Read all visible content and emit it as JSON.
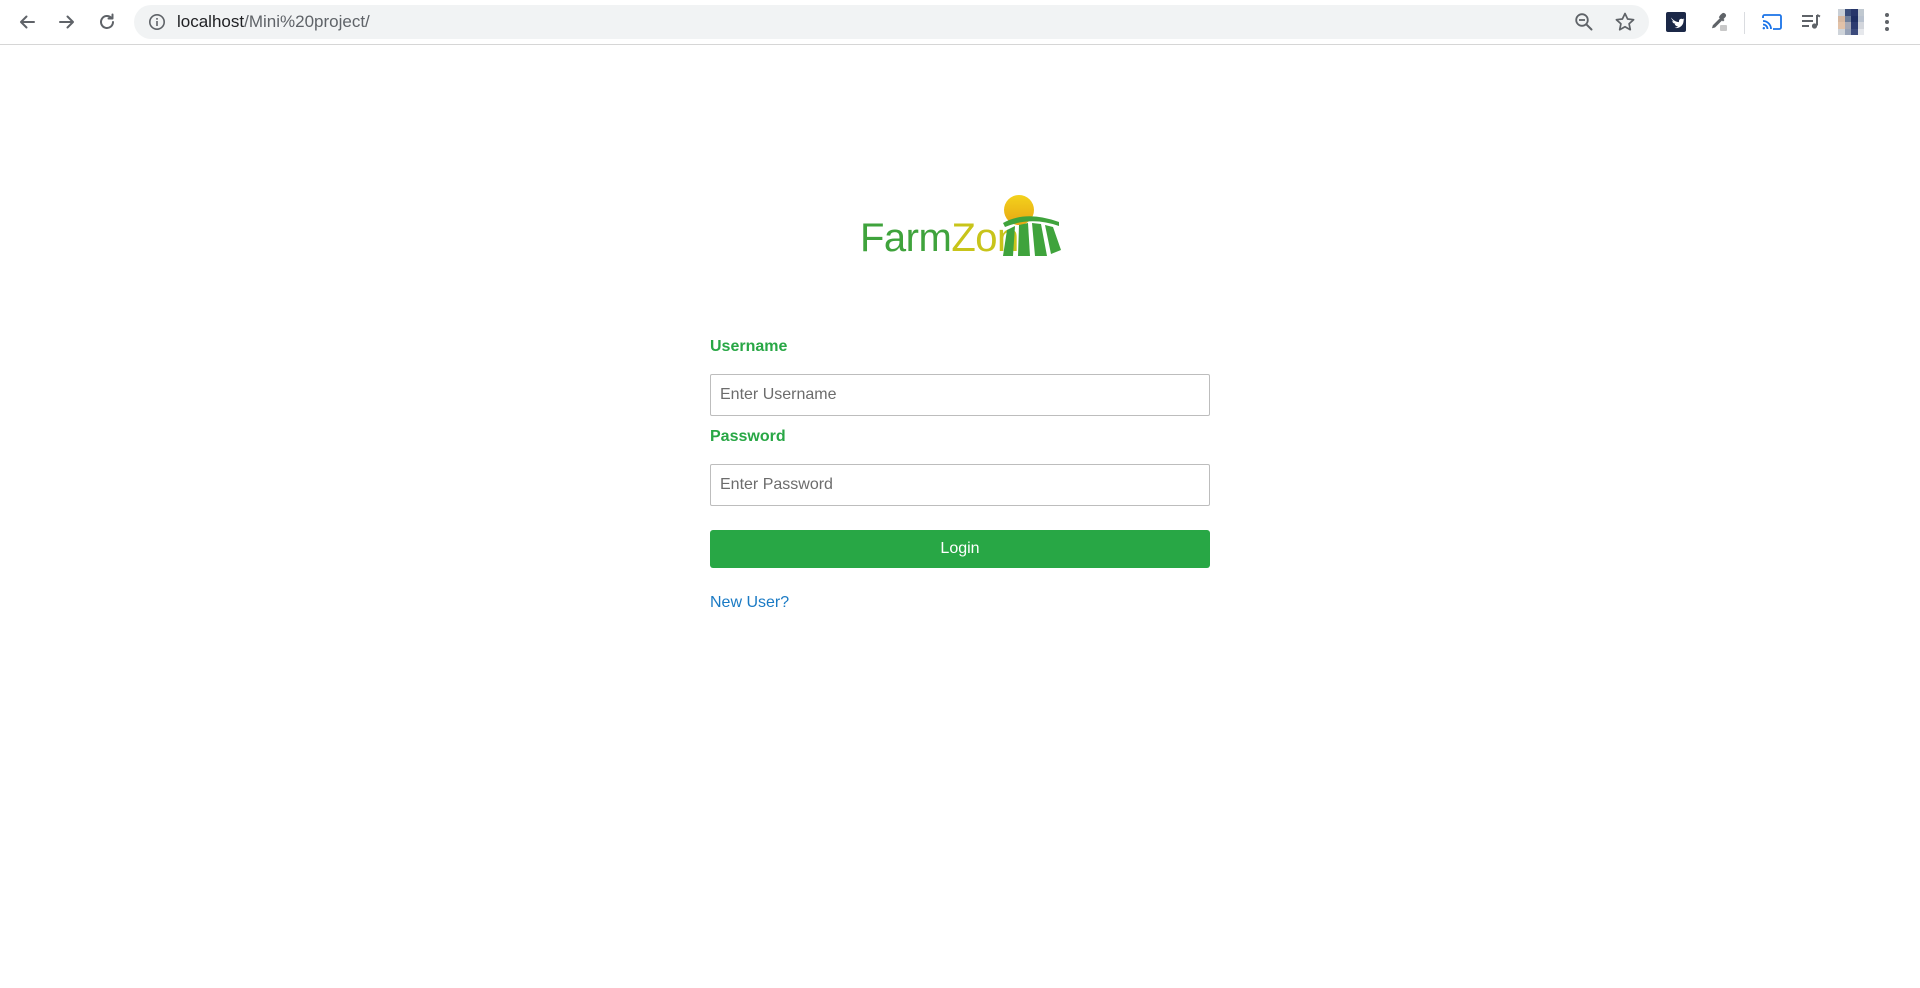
{
  "browser": {
    "url_host": "localhost",
    "url_path": "/Mini%20project/",
    "icons": {
      "back": "arrow-left-icon",
      "forward": "arrow-right-icon",
      "reload": "reload-icon",
      "info": "info-icon",
      "zoom": "zoom-out-icon",
      "bookmark": "star-icon",
      "extensions": [
        "twitter-extension-icon",
        "eyedropper-extension-icon",
        "cast-icon",
        "media-control-icon"
      ],
      "profile": "avatar",
      "menu": "kebab-menu-icon"
    }
  },
  "logo": {
    "text_farm": "Farm",
    "text_zon": "Zon",
    "colors": {
      "farm": "#3fa33c",
      "zon": "#c8c41a",
      "sun": "#f2c318",
      "field": "#3fa33c"
    }
  },
  "form": {
    "username_label": "Username",
    "username_placeholder": "Enter Username",
    "username_value": "",
    "password_label": "Password",
    "password_placeholder": "Enter Password",
    "password_value": "",
    "login_label": "Login",
    "new_user_link": "New User?"
  },
  "colors": {
    "primary_green": "#28a745",
    "link_blue": "#1a7ac4"
  }
}
